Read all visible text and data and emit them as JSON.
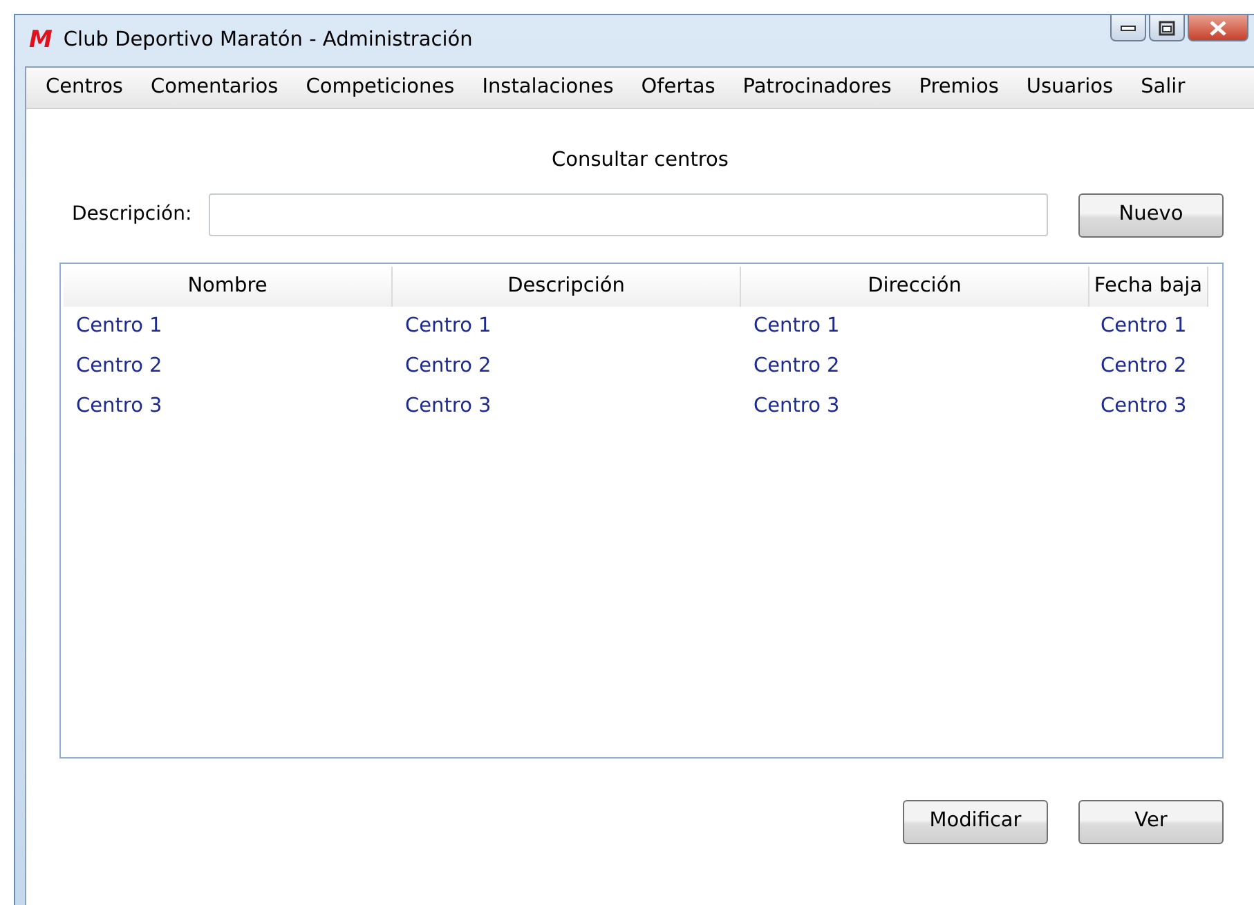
{
  "window": {
    "title": "Club Deportivo Maratón - Administración",
    "logo": "M"
  },
  "menu": [
    "Centros",
    "Comentarios",
    "Competiciones",
    "Instalaciones",
    "Ofertas",
    "Patrocinadores",
    "Premios",
    "Usuarios",
    "Salir"
  ],
  "heading": "Consultar centros",
  "filter": {
    "label": "Descripción:"
  },
  "new_button": "Nuevo",
  "table": {
    "columns": [
      "Nombre",
      "Descripción",
      "Dirección",
      "Fecha baja"
    ],
    "rows": [
      [
        "Centro 1",
        "Centro 1",
        "Centro 1",
        "Centro 1"
      ],
      [
        "Centro 2",
        "Centro 2",
        "Centro 2",
        "Centro 2"
      ],
      [
        "Centro 3",
        "Centro 3",
        "Centro 3",
        "Centro 3"
      ]
    ]
  },
  "buttons": [
    "Modificar",
    "Ver"
  ]
}
